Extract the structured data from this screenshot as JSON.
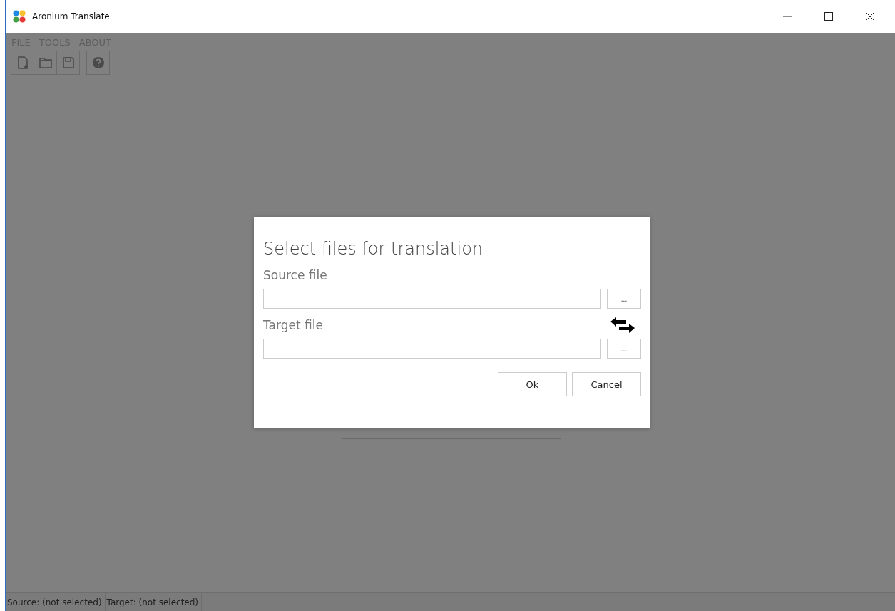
{
  "window": {
    "title": "Aronium Translate"
  },
  "menu": [
    {
      "label": "FILE"
    },
    {
      "label": "TOOLS"
    },
    {
      "label": "ABOUT"
    }
  ],
  "toolbar": [
    [
      {
        "kind": "new"
      },
      {
        "kind": "open"
      },
      {
        "kind": "save"
      }
    ],
    [
      {
        "kind": "help"
      }
    ]
  ],
  "dialog": {
    "title": "Select files for translation",
    "fields": [
      {
        "label": "Source file",
        "browse": "..."
      },
      {
        "label": "Target file",
        "browse": "..."
      }
    ],
    "buttons": [
      "Ok",
      "Cancel"
    ]
  },
  "status_bar": [
    {
      "text": "Source: (not selected)"
    },
    {
      "text": "Target: (not selected)"
    }
  ]
}
